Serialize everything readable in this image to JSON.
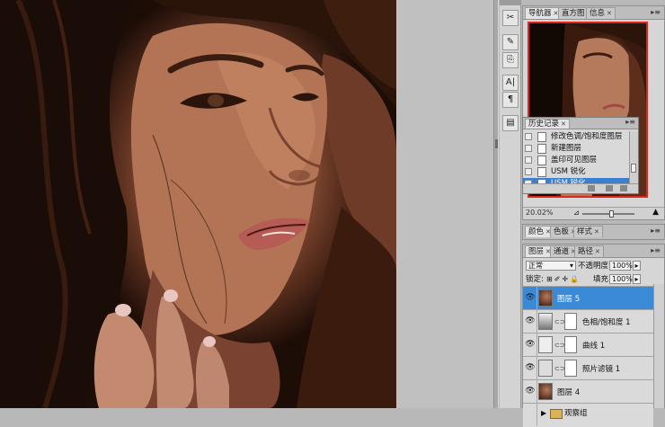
{
  "toolbar": {
    "icons": [
      "scissors-icon",
      "brush-icon",
      "stamp-icon",
      "text-icon",
      "paragraph-icon",
      "layers-doc-icon"
    ],
    "labels": [
      "✂",
      "✎",
      "⎘",
      "A|",
      "¶",
      "▤"
    ]
  },
  "navigator_panel": {
    "tabs": [
      "导航器",
      "直方图",
      "信息"
    ],
    "zoom": "20.02%",
    "slider_level": 0.55
  },
  "history_panel": {
    "tab": "历史记录",
    "items": [
      {
        "label": "修改色调/饱和度图层",
        "selected": false
      },
      {
        "label": "新建图层",
        "selected": false
      },
      {
        "label": "盖印可见图层",
        "selected": false
      },
      {
        "label": "USM 锐化",
        "selected": false
      },
      {
        "label": "USM 锐化",
        "selected": true
      }
    ]
  },
  "color_panel": {
    "tabs": [
      "颜色",
      "色板",
      "样式"
    ]
  },
  "layers_panel": {
    "tabs": [
      "图层",
      "通道",
      "路径"
    ],
    "blend_mode": "正常",
    "opacity_label": "不透明度:",
    "opacity": "100%",
    "lock_label": "锁定:",
    "fill_label": "填充:",
    "fill": "100%",
    "layers": [
      {
        "name": "图层 5",
        "selected": true,
        "type": "photo"
      },
      {
        "name": "色相/饱和度 1",
        "selected": false,
        "type": "adjust"
      },
      {
        "name": "曲线 1",
        "selected": false,
        "type": "curve"
      },
      {
        "name": "照片滤镜 1",
        "selected": false,
        "type": "filter"
      },
      {
        "name": "图层 4",
        "selected": false,
        "type": "photo"
      },
      {
        "name": "观察组",
        "selected": false,
        "type": "group"
      }
    ]
  },
  "colors": {
    "selection": "#3b8ad8",
    "navigator_frame": "#e0251b"
  }
}
